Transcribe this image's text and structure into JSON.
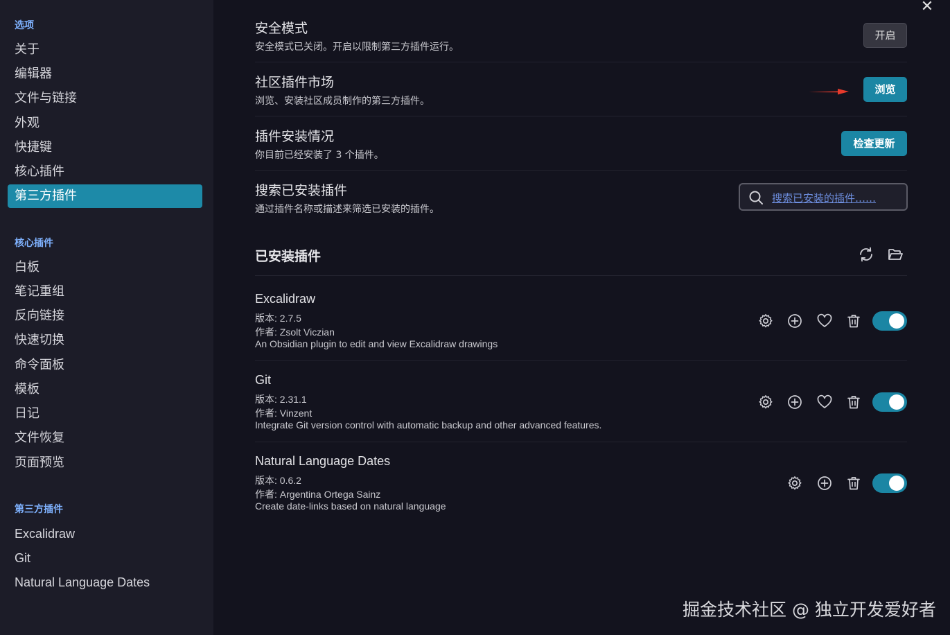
{
  "sidebar": {
    "options_header": "选项",
    "options": [
      "关于",
      "编辑器",
      "文件与链接",
      "外观",
      "快捷键",
      "核心插件",
      "第三方插件"
    ],
    "active_option": "第三方插件",
    "core_header": "核心插件",
    "core_plugins": [
      "白板",
      "笔记重组",
      "反向链接",
      "快速切换",
      "命令面板",
      "模板",
      "日记",
      "文件恢复",
      "页面预览"
    ],
    "community_header": "第三方插件",
    "community_plugins": [
      "Excalidraw",
      "Git",
      "Natural Language Dates"
    ]
  },
  "close_icon": "close-icon",
  "settings": {
    "safe_mode": {
      "title": "安全模式",
      "desc": "安全模式已关闭。开启以限制第三方插件运行。",
      "button": "开启"
    },
    "market": {
      "title": "社区插件市场",
      "desc": "浏览、安装社区成员制作的第三方插件。",
      "button": "浏览"
    },
    "installed_status": {
      "title": "插件安装情况",
      "desc": "你目前已经安装了 3 个插件。",
      "button": "检查更新"
    },
    "search": {
      "title": "搜索已安装插件",
      "desc": "通过插件名称或描述来筛选已安装的插件。",
      "placeholder": "搜索已安装的插件……"
    }
  },
  "installed": {
    "heading": "已安装插件",
    "icons": [
      "refresh-icon",
      "folder-open-icon"
    ],
    "plugins": [
      {
        "name": "Excalidraw",
        "version": "版本: 2.7.5",
        "author": "作者:  Zsolt Viczian",
        "description": "An Obsidian plugin to edit and view Excalidraw drawings",
        "enabled": true
      },
      {
        "name": "Git",
        "version": "版本: 2.31.1",
        "author": "作者:  Vinzent",
        "description": "Integrate Git version control with automatic backup and other advanced features.",
        "enabled": true
      },
      {
        "name": "Natural Language Dates",
        "version": "版本: 0.6.2",
        "author": "作者:  Argentina Ortega Sainz",
        "description": "Create date-links based on natural language",
        "enabled": true
      }
    ]
  },
  "watermark": "掘金技术社区 @ 独立开发爱好者",
  "colors": {
    "accent": "#1b86a4",
    "sidebar_bg": "#1c1c28",
    "main_bg": "#13131e",
    "link": "#7fb2ff",
    "arrow": "#e53a2c"
  }
}
